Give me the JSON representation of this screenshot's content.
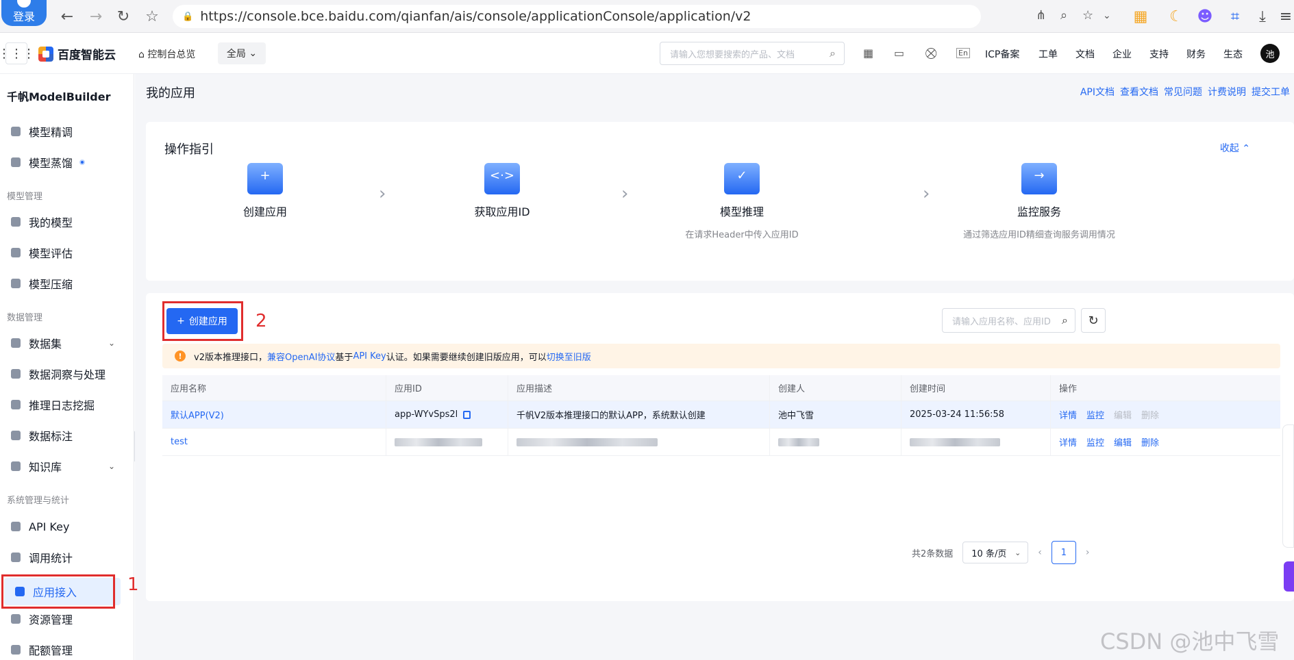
{
  "browser": {
    "login_badge": "登录",
    "url": "https://console.bce.baidu.com/qianfan/ais/console/applicationConsole/application/v2"
  },
  "header": {
    "logo_text": "百度智能云",
    "overview": "控制台总览",
    "region": "全局",
    "search_placeholder": "请输入您想要搜索的产品、文档",
    "links": [
      "ICP备案",
      "工单",
      "文档",
      "企业",
      "支持",
      "财务",
      "生态"
    ],
    "avatar_text": "池"
  },
  "sidebar": {
    "title": "千帆ModelBuilder",
    "items": [
      {
        "label": "模型精调"
      },
      {
        "label": "模型蒸馏"
      },
      {
        "label": "我的模型"
      },
      {
        "label": "模型评估"
      },
      {
        "label": "模型压缩"
      },
      {
        "label": "数据集"
      },
      {
        "label": "数据洞察与处理"
      },
      {
        "label": "推理日志挖掘"
      },
      {
        "label": "数据标注"
      },
      {
        "label": "知识库"
      },
      {
        "label": "API Key"
      },
      {
        "label": "调用统计"
      },
      {
        "label": "应用接入"
      },
      {
        "label": "资源管理"
      },
      {
        "label": "配额管理"
      }
    ],
    "groups": [
      "模型管理",
      "数据管理",
      "系统管理与统计"
    ]
  },
  "main": {
    "page_title": "我的应用",
    "top_links": [
      "API文档",
      "查看文档",
      "常见问题",
      "计费说明",
      "提交工单"
    ]
  },
  "guide": {
    "title": "操作指引",
    "collapse": "收起",
    "steps": [
      {
        "name": "创建应用",
        "desc": ""
      },
      {
        "name": "获取应用ID",
        "desc": ""
      },
      {
        "name": "模型推理",
        "desc": "在请求Header中传入应用ID"
      },
      {
        "name": "监控服务",
        "desc": "通过筛选应用ID精细查询服务调用情况"
      }
    ]
  },
  "apps": {
    "create_button": "创建应用",
    "search_placeholder": "请输入应用名称、应用ID",
    "notice": {
      "t1": "v2版本推理接口，",
      "l1": "兼容OpenAI协议",
      "t2": "基于",
      "l2": "API Key",
      "t3": "认证。如果需要继续创建旧版应用，可以",
      "l3": "切换至旧版"
    },
    "columns": [
      "应用名称",
      "应用ID",
      "应用描述",
      "创建人",
      "创建时间",
      "操作"
    ],
    "rows": [
      {
        "name": "默认APP(V2)",
        "id": "app-WYvSps2l",
        "desc": "千帆V2版本推理接口的默认APP，系统默认创建",
        "creator": "池中飞雪",
        "created": "2025-03-24 11:56:58",
        "ops": [
          "详情",
          "监控",
          "编辑",
          "删除"
        ]
      },
      {
        "name": "test",
        "id": "",
        "desc": "",
        "creator": "",
        "created": "",
        "ops": [
          "详情",
          "监控",
          "编辑",
          "删除"
        ]
      }
    ],
    "total": "共2条数据",
    "page_size": "10 条/页",
    "page": "1"
  },
  "annotations": {
    "one": "1",
    "two": "2"
  },
  "watermark": "CSDN @池中飞雪"
}
